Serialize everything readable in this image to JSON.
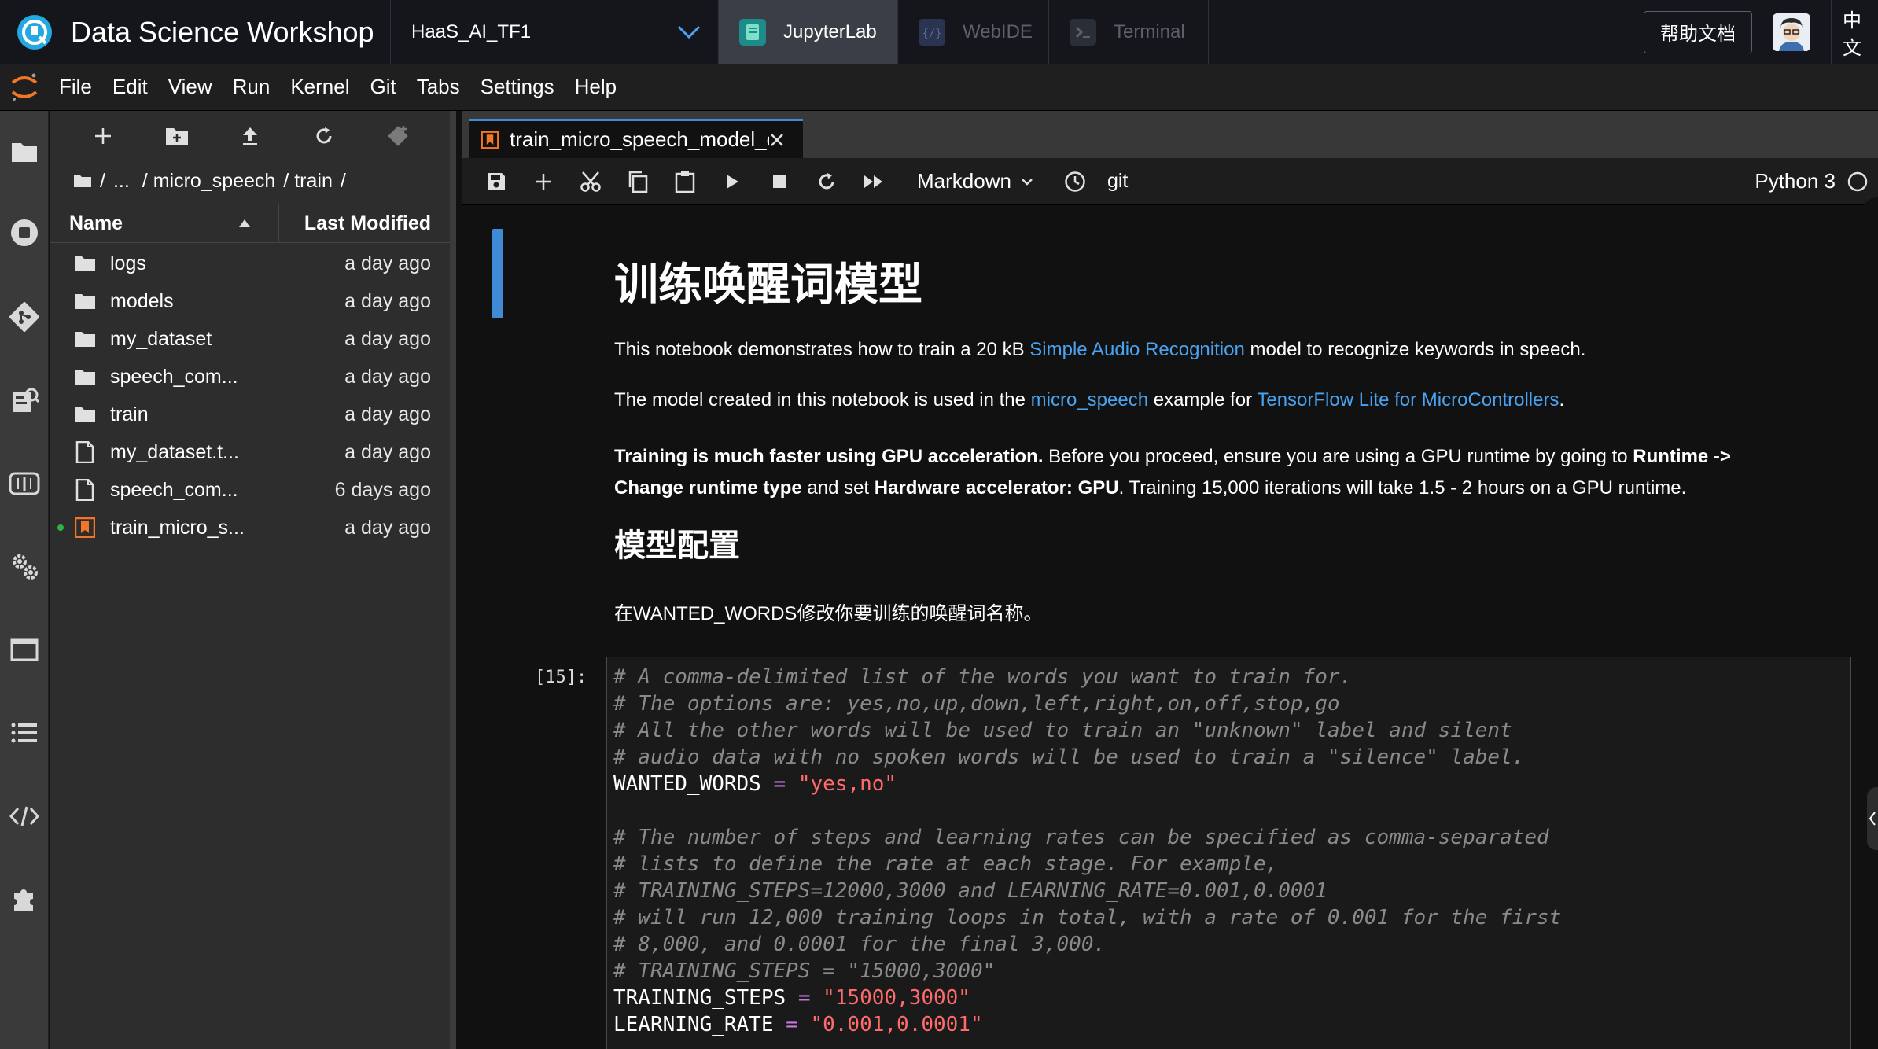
{
  "header": {
    "title": "Data Science Workshop",
    "project": "HaaS_AI_TF1",
    "apps": [
      {
        "label": "JupyterLab",
        "active": true
      },
      {
        "label": "WebIDE",
        "active": false
      },
      {
        "label": "Terminal",
        "active": false
      }
    ],
    "help_label": "帮助文档",
    "lang_label": "中文"
  },
  "menu": [
    "File",
    "Edit",
    "View",
    "Run",
    "Kernel",
    "Git",
    "Tabs",
    "Settings",
    "Help"
  ],
  "filebrowser": {
    "breadcrumb": [
      "/",
      "...",
      "/ micro_speech",
      "/ train",
      "/"
    ],
    "col_name": "Name",
    "col_modified": "Last Modified",
    "files": [
      {
        "name": "logs",
        "type": "folder",
        "modified": "a day ago"
      },
      {
        "name": "models",
        "type": "folder",
        "modified": "a day ago"
      },
      {
        "name": "my_dataset",
        "type": "folder",
        "modified": "a day ago"
      },
      {
        "name": "speech_com...",
        "type": "folder",
        "modified": "a day ago"
      },
      {
        "name": "train",
        "type": "folder",
        "modified": "a day ago"
      },
      {
        "name": "my_dataset.t...",
        "type": "file",
        "modified": "a day ago"
      },
      {
        "name": "speech_com...",
        "type": "file",
        "modified": "6 days ago"
      },
      {
        "name": "train_micro_s...",
        "type": "notebook",
        "modified": "a day ago",
        "running": true
      }
    ]
  },
  "notebook": {
    "tab_title": "train_micro_speech_model_c",
    "cell_type": "Markdown",
    "git_label": "git",
    "kernel": "Python 3",
    "markdown": {
      "h1": "训练唤醒词模型",
      "p1_a": "This notebook demonstrates how to train a 20 kB ",
      "p1_link": "Simple Audio Recognition",
      "p1_b": " model to recognize keywords in speech.",
      "p2_a": "The model created in this notebook is used in the ",
      "p2_link1": "micro_speech",
      "p2_b": " example for ",
      "p2_link2": "TensorFlow Lite for MicroControllers",
      "p2_c": ".",
      "p3_b1": "Training is much faster using GPU acceleration.",
      "p3_t1": " Before you proceed, ensure you are using a GPU runtime by going to ",
      "p3_b2": "Runtime ->",
      "p4_b1": "Change runtime type",
      "p4_t1": " and set ",
      "p4_b2": "Hardware accelerator: GPU",
      "p4_t2": ". Training 15,000 iterations will take 1.5 - 2 hours on a GPU runtime.",
      "h2": "模型配置",
      "p5": "在WANTED_WORDS修改你要训练的唤醒词名称。"
    },
    "code_prompt": "[15]:",
    "code": {
      "c1": "# A comma-delimited list of the words you want to train for.",
      "c2": "# The options are: yes,no,up,down,left,right,on,off,stop,go",
      "c3": "# All the other words will be used to train an \"unknown\" label and silent",
      "c4": "# audio data with no spoken words will be used to train a \"silence\" label.",
      "wanted_var": "WANTED_WORDS",
      "wanted_val": "\"yes,no\"",
      "c5": "# The number of steps and learning rates can be specified as comma-separated",
      "c6": "# lists to define the rate at each stage. For example,",
      "c7": "# TRAINING_STEPS=12000,3000 and LEARNING_RATE=0.001,0.0001",
      "c8": "# will run 12,000 training loops in total, with a rate of 0.001 for the first",
      "c9": "# 8,000, and 0.0001 for the final 3,000.",
      "c10": "# TRAINING_STEPS = \"15000,3000\"",
      "steps_var": "TRAINING_STEPS",
      "steps_val": "\"15000,3000\"",
      "lr_var": "LEARNING_RATE",
      "lr_val": "\"0.001,0.0001\"",
      "eq": "="
    }
  },
  "icons": [
    "brand-logo-icon",
    "chevron-down-icon",
    "jupyter-logo-icon",
    "folder-icon",
    "stop-circle-icon",
    "git-icon",
    "property-inspector-icon",
    "book-icon",
    "gears-icon",
    "window-icon",
    "list-icon",
    "code-icon",
    "puzzle-icon",
    "plus-icon",
    "new-folder-icon",
    "upload-icon",
    "refresh-icon",
    "git-clone-icon",
    "save-icon",
    "scissors-icon",
    "copy-icon",
    "paste-icon",
    "run-icon",
    "stop-icon",
    "restart-icon",
    "fast-forward-icon",
    "clock-icon",
    "close-icon",
    "kernel-idle-icon",
    "file-icon",
    "notebook-icon"
  ],
  "colors": {
    "accent": "#3f8bd6",
    "link": "#4aa3f0",
    "string": "#ff6b6b",
    "operator": "#c678dd",
    "running": "#2fb344"
  }
}
